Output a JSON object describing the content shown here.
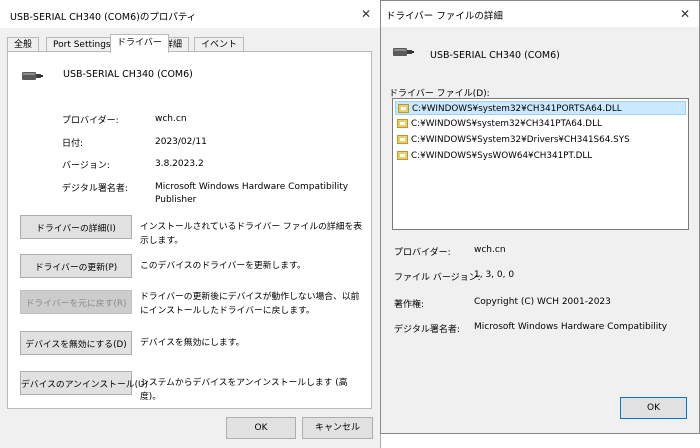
{
  "properties_window": {
    "title": "USB-SERIAL CH340 (COM6)のプロパティ",
    "tabs": [
      "全般",
      "Port Settings",
      "ドライバー",
      "詳細",
      "イベント"
    ],
    "active_tab": "ドライバー",
    "device_name": "USB-SERIAL CH340 (COM6)",
    "fields": [
      {
        "label": "プロバイダー:",
        "value": "wch.cn"
      },
      {
        "label": "日付:",
        "value": "2023/02/11"
      },
      {
        "label": "バージョン:",
        "value": "3.8.2023.2"
      },
      {
        "label": "デジタル署名者:",
        "value": "Microsoft Windows Hardware Compatibility Publisher"
      }
    ],
    "actions": [
      {
        "button": "ドライバーの詳細(I)",
        "description": "インストールされているドライバー ファイルの詳細を表示します。",
        "enabled": true
      },
      {
        "button": "ドライバーの更新(P)",
        "description": "このデバイスのドライバーを更新します。",
        "enabled": true
      },
      {
        "button": "ドライバーを元に戻す(R)",
        "description": "ドライバーの更新後にデバイスが動作しない場合、以前にインストールしたドライバーに戻します。",
        "enabled": false
      },
      {
        "button": "デバイスを無効にする(D)",
        "description": "デバイスを無効にします。",
        "enabled": true
      },
      {
        "button": "デバイスのアンインストール(U)",
        "description": "システムからデバイスをアンインストールします (高度)。",
        "enabled": true
      }
    ],
    "ok_label": "OK",
    "cancel_label": "キャンセル"
  },
  "details_window": {
    "title": "ドライバー ファイルの詳細",
    "device_name": "USB-SERIAL CH340 (COM6)",
    "files_label": "ドライバー ファイル(D):",
    "files": [
      "C:¥WINDOWS¥system32¥CH341PORTSA64.DLL",
      "C:¥WINDOWS¥system32¥CH341PTA64.DLL",
      "C:¥WINDOWS¥System32¥Drivers¥CH341S64.SYS",
      "C:¥WINDOWS¥SysWOW64¥CH341PT.DLL"
    ],
    "selected_file_index": 0,
    "info": [
      {
        "label": "プロバイダー:",
        "value": "wch.cn"
      },
      {
        "label": "ファイル バージョン:",
        "value": "1, 3, 0, 0"
      },
      {
        "label": "著作権:",
        "value": "Copyright (C) WCH 2001-2023"
      },
      {
        "label": "デジタル署名者:",
        "value": "Microsoft Windows Hardware Compatibility"
      }
    ],
    "ok_label": "OK"
  },
  "icons": {
    "close": "close-icon",
    "device": "usb-serial-device-icon",
    "file": "driver-file-icon"
  }
}
